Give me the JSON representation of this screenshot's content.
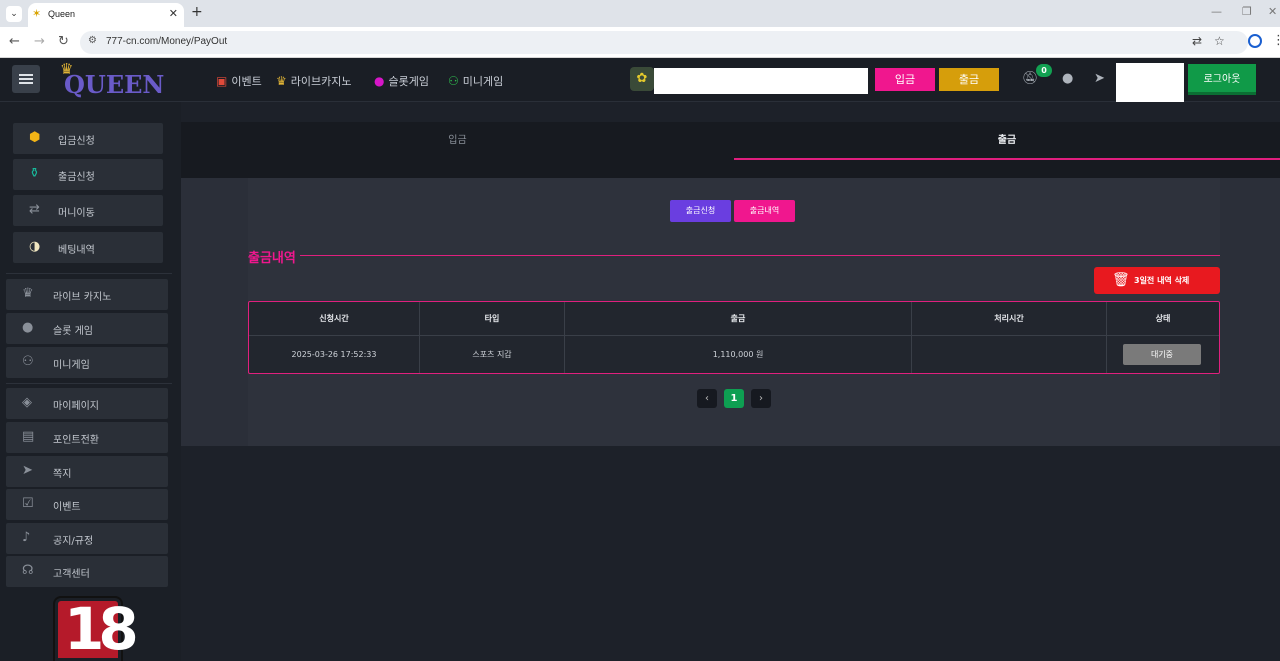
{
  "browser": {
    "tab_title": "Queen",
    "tab_icon": "sparkle-icon",
    "new_tab_symbol": "+",
    "url": "777-cn.com/Money/PayOut"
  },
  "header": {
    "logo_text": "QUEEN",
    "nav": [
      {
        "label": "이벤트",
        "icon": "gift-icon"
      },
      {
        "label": "라이브카지노",
        "icon": "crown-icon"
      },
      {
        "label": "슬롯게임",
        "icon": "dot-icon"
      },
      {
        "label": "미니게임",
        "icon": "gamepad-icon"
      }
    ],
    "deposit_label": "입금",
    "withdraw_label": "출금",
    "notification_count": "0",
    "logout_label": "로그아웃"
  },
  "sidebar": {
    "top_buttons": [
      {
        "label": "입금신청",
        "icon": "coin-icon"
      },
      {
        "label": "출금신청",
        "icon": "bottle-icon"
      },
      {
        "label": "머니이동",
        "icon": "swap-icon"
      },
      {
        "label": "베팅내역",
        "icon": "ball-icon"
      }
    ],
    "game_links": [
      {
        "label": "라이브 카지노",
        "icon": "crown-icon"
      },
      {
        "label": "슬롯 게임",
        "icon": "dot-icon"
      },
      {
        "label": "미니게임",
        "icon": "gamepad-icon"
      }
    ],
    "account_links": [
      {
        "label": "마이페이지",
        "icon": "bag-icon"
      },
      {
        "label": "포인트전환",
        "icon": "document-icon"
      },
      {
        "label": "쪽지",
        "icon": "send-icon"
      },
      {
        "label": "이벤트",
        "icon": "calendar-icon"
      },
      {
        "label": "공지/규정",
        "icon": "bell-icon"
      },
      {
        "label": "고객센터",
        "icon": "chat-icon"
      }
    ],
    "age_badge": "18"
  },
  "main": {
    "tabs": [
      {
        "label": "입금",
        "active": false
      },
      {
        "label": "출금",
        "active": true
      }
    ],
    "sub_buttons": {
      "request": "출금신청",
      "history": "출금내역"
    },
    "section_title": "출금내역",
    "delete_button": "3일전 내역 삭제",
    "table": {
      "headers": [
        "신청시간",
        "타입",
        "출금",
        "처리시간",
        "상태"
      ],
      "rows": [
        {
          "time": "2025-03-26 17:52:33",
          "type": "스포츠 지갑",
          "amount": "1,110,000 원",
          "processed": "",
          "status": "대기중"
        }
      ]
    },
    "pagination": {
      "prev": "‹",
      "current": "1",
      "next": "›"
    }
  },
  "colors": {
    "accent_pink": "#f0178e",
    "gold": "#d69e0b",
    "green": "#109a48",
    "purple": "#6a3ee0",
    "red": "#e8191f"
  }
}
